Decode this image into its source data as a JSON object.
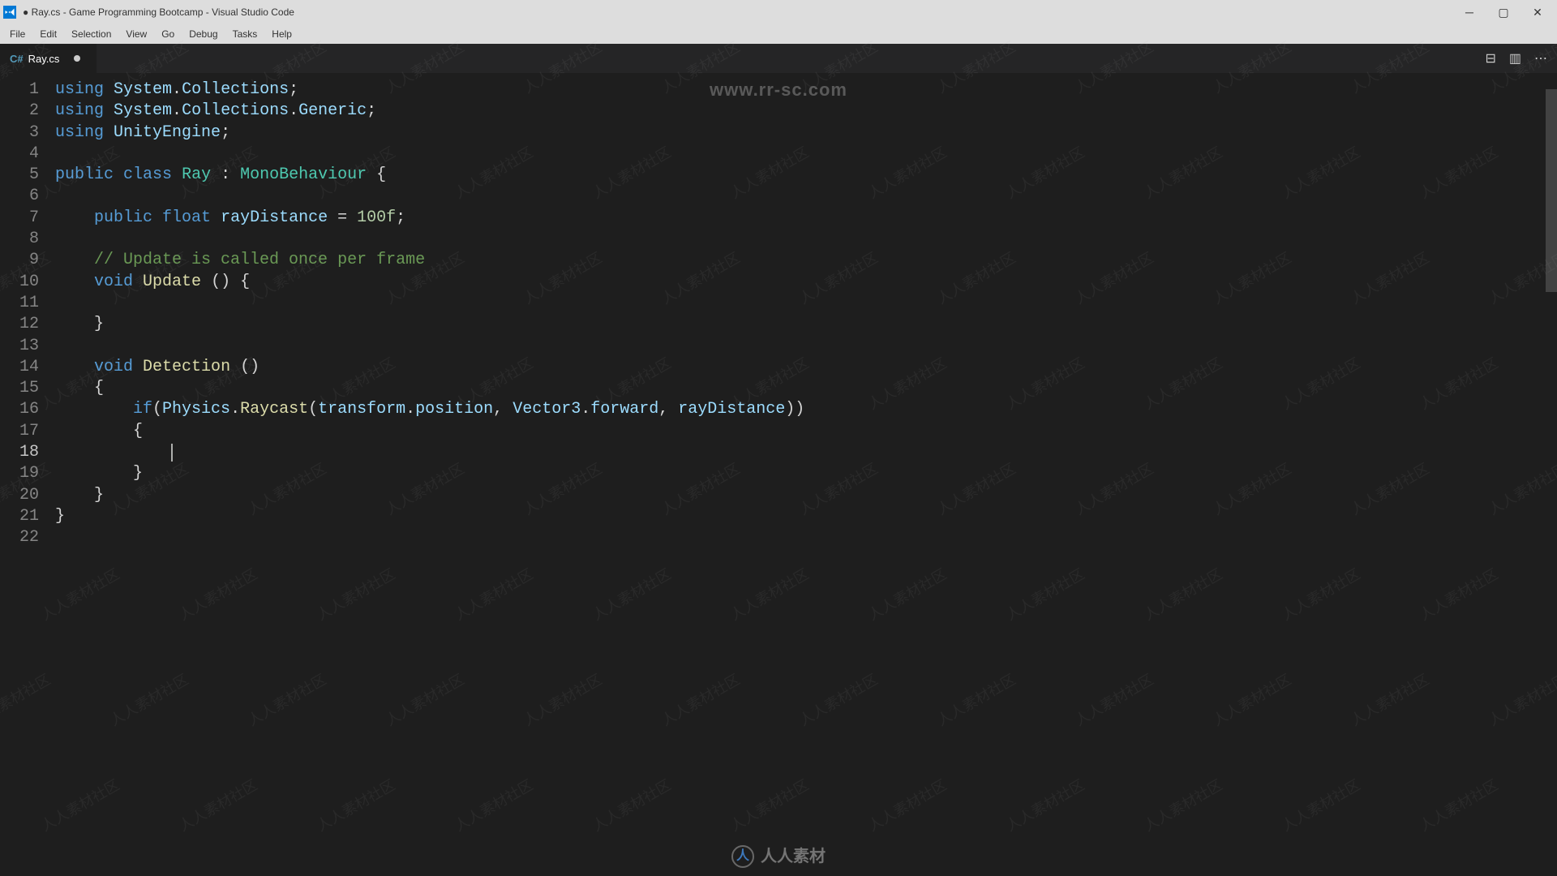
{
  "window": {
    "title": "● Ray.cs - Game Programming Bootcamp - Visual Studio Code"
  },
  "menu": {
    "file": "File",
    "edit": "Edit",
    "selection": "Selection",
    "view": "View",
    "go": "Go",
    "debug": "Debug",
    "tasks": "Tasks",
    "help": "Help"
  },
  "tab": {
    "filename": "Ray.cs",
    "icon_label": "C#"
  },
  "editor_actions": {
    "diff": "⊟",
    "split": "▥",
    "more": "⋯"
  },
  "code": {
    "lines": [
      {
        "n": "1",
        "segs": [
          {
            "t": "using",
            "c": "kw"
          },
          {
            "t": " ",
            "c": "punct"
          },
          {
            "t": "System",
            "c": "var"
          },
          {
            "t": ".",
            "c": "punct"
          },
          {
            "t": "Collections",
            "c": "var"
          },
          {
            "t": ";",
            "c": "punct"
          }
        ]
      },
      {
        "n": "2",
        "segs": [
          {
            "t": "using",
            "c": "kw"
          },
          {
            "t": " ",
            "c": "punct"
          },
          {
            "t": "System",
            "c": "var"
          },
          {
            "t": ".",
            "c": "punct"
          },
          {
            "t": "Collections",
            "c": "var"
          },
          {
            "t": ".",
            "c": "punct"
          },
          {
            "t": "Generic",
            "c": "var"
          },
          {
            "t": ";",
            "c": "punct"
          }
        ]
      },
      {
        "n": "3",
        "segs": [
          {
            "t": "using",
            "c": "kw"
          },
          {
            "t": " ",
            "c": "punct"
          },
          {
            "t": "UnityEngine",
            "c": "var"
          },
          {
            "t": ";",
            "c": "punct"
          }
        ]
      },
      {
        "n": "4",
        "segs": []
      },
      {
        "n": "5",
        "segs": [
          {
            "t": "public",
            "c": "kw"
          },
          {
            "t": " ",
            "c": "punct"
          },
          {
            "t": "class",
            "c": "kw"
          },
          {
            "t": " ",
            "c": "punct"
          },
          {
            "t": "Ray",
            "c": "type"
          },
          {
            "t": " : ",
            "c": "punct"
          },
          {
            "t": "MonoBehaviour",
            "c": "type"
          },
          {
            "t": " {",
            "c": "punct"
          }
        ]
      },
      {
        "n": "6",
        "segs": []
      },
      {
        "n": "7",
        "segs": [
          {
            "t": "    ",
            "c": "punct"
          },
          {
            "t": "public",
            "c": "kw"
          },
          {
            "t": " ",
            "c": "punct"
          },
          {
            "t": "float",
            "c": "kw"
          },
          {
            "t": " ",
            "c": "punct"
          },
          {
            "t": "rayDistance",
            "c": "var"
          },
          {
            "t": " = ",
            "c": "punct"
          },
          {
            "t": "100f",
            "c": "num"
          },
          {
            "t": ";",
            "c": "punct"
          }
        ]
      },
      {
        "n": "8",
        "segs": []
      },
      {
        "n": "9",
        "segs": [
          {
            "t": "    ",
            "c": "punct"
          },
          {
            "t": "// Update is called once per frame",
            "c": "comment"
          }
        ]
      },
      {
        "n": "10",
        "segs": [
          {
            "t": "    ",
            "c": "punct"
          },
          {
            "t": "void",
            "c": "kw"
          },
          {
            "t": " ",
            "c": "punct"
          },
          {
            "t": "Update",
            "c": "method"
          },
          {
            "t": " () {",
            "c": "punct"
          }
        ]
      },
      {
        "n": "11",
        "segs": [
          {
            "t": "        ",
            "c": "punct"
          }
        ]
      },
      {
        "n": "12",
        "segs": [
          {
            "t": "    }",
            "c": "punct"
          }
        ]
      },
      {
        "n": "13",
        "segs": []
      },
      {
        "n": "14",
        "segs": [
          {
            "t": "    ",
            "c": "punct"
          },
          {
            "t": "void",
            "c": "kw"
          },
          {
            "t": " ",
            "c": "punct"
          },
          {
            "t": "Detection",
            "c": "method"
          },
          {
            "t": " ()",
            "c": "punct"
          }
        ]
      },
      {
        "n": "15",
        "segs": [
          {
            "t": "    {",
            "c": "punct"
          }
        ]
      },
      {
        "n": "16",
        "segs": [
          {
            "t": "        ",
            "c": "punct"
          },
          {
            "t": "if",
            "c": "kw"
          },
          {
            "t": "(",
            "c": "punct"
          },
          {
            "t": "Physics",
            "c": "var"
          },
          {
            "t": ".",
            "c": "punct"
          },
          {
            "t": "Raycast",
            "c": "method"
          },
          {
            "t": "(",
            "c": "punct"
          },
          {
            "t": "transform",
            "c": "var"
          },
          {
            "t": ".",
            "c": "punct"
          },
          {
            "t": "position",
            "c": "var"
          },
          {
            "t": ", ",
            "c": "punct"
          },
          {
            "t": "Vector3",
            "c": "var"
          },
          {
            "t": ".",
            "c": "punct"
          },
          {
            "t": "forward",
            "c": "var"
          },
          {
            "t": ", ",
            "c": "punct"
          },
          {
            "t": "rayDistance",
            "c": "var"
          },
          {
            "t": "))",
            "c": "punct"
          }
        ]
      },
      {
        "n": "17",
        "segs": [
          {
            "t": "        {",
            "c": "punct"
          }
        ]
      },
      {
        "n": "18",
        "cursor": true,
        "segs": [
          {
            "t": "            ",
            "c": "punct"
          }
        ]
      },
      {
        "n": "19",
        "segs": [
          {
            "t": "        }",
            "c": "punct"
          }
        ]
      },
      {
        "n": "20",
        "segs": [
          {
            "t": "    }",
            "c": "punct"
          }
        ]
      },
      {
        "n": "21",
        "segs": [
          {
            "t": "}",
            "c": "punct"
          }
        ]
      },
      {
        "n": "22",
        "segs": []
      }
    ]
  },
  "watermark": {
    "url": "www.rr-sc.com",
    "tile_text": "人人素材社区",
    "footer_text": "人人素材",
    "footer_logo": "人"
  }
}
